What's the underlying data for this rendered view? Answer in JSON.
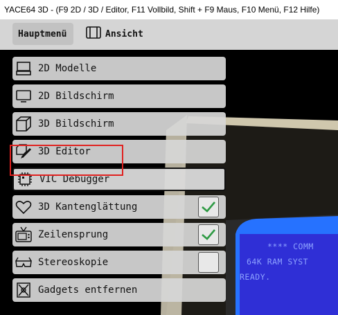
{
  "window": {
    "title": "YACE64 3D - (F9 2D / 3D / Editor, F11 Vollbild, Shift + F9 Maus, F10 Menü, F12 Hilfe)"
  },
  "menubar": {
    "tabs": [
      {
        "label": "Hauptmenü",
        "active": true
      },
      {
        "label": "Ansicht",
        "icon": "view-panel-icon",
        "active": false
      }
    ]
  },
  "menu": {
    "items": [
      {
        "label": "2D Modelle",
        "icon": "computer-icon"
      },
      {
        "label": "2D Bildschirm",
        "icon": "monitor-icon"
      },
      {
        "label": "3D Bildschirm",
        "icon": "cube-icon"
      },
      {
        "label": "3D Editor",
        "icon": "pencil-cube-icon"
      },
      {
        "label": "VIC Debugger",
        "icon": "chip-icon",
        "selected": true
      },
      {
        "label": "3D Kantenglättung",
        "icon": "heart-icon",
        "checkbox": true,
        "checked": true
      },
      {
        "label": "Zeilensprung",
        "icon": "tv-icon",
        "checkbox": true,
        "checked": true
      },
      {
        "label": "Stereoskopie",
        "icon": "3d-glasses-icon",
        "checkbox": true,
        "checked": false
      },
      {
        "label": "Gadgets entfernen",
        "icon": "gadget-remove-icon"
      }
    ]
  },
  "c64_screen": {
    "lines": [
      "**** COMM",
      "64K RAM SYST",
      "READY."
    ]
  },
  "colors": {
    "checkmark": "#2e9a44",
    "highlight": "#e0211f",
    "c64_background": "#2f2fd6",
    "c64_text": "#8da2ff"
  }
}
